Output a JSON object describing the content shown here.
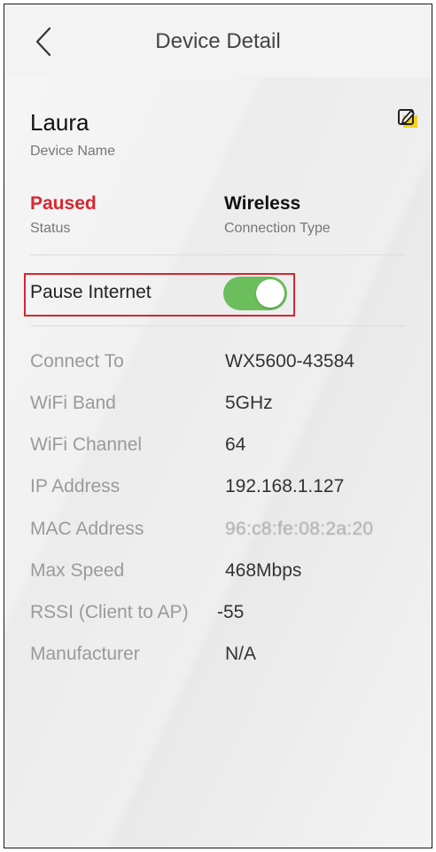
{
  "header": {
    "title": "Device Detail",
    "back_icon": "chevron-left-icon"
  },
  "device": {
    "name": "Laura",
    "name_label": "Device Name",
    "edit_icon": "edit-icon",
    "status": "Paused",
    "status_label": "Status",
    "status_color": "#d9262f",
    "connection_type": "Wireless",
    "connection_type_label": "Connection Type"
  },
  "pause_internet": {
    "label": "Pause Internet",
    "enabled": true,
    "toggle_color": "#6cbd5c",
    "highlight_color": "#d7262f"
  },
  "details": [
    {
      "label": "Connect To",
      "value": "WX5600-43584"
    },
    {
      "label": "WiFi Band",
      "value": "5GHz"
    },
    {
      "label": "WiFi Channel",
      "value": "64"
    },
    {
      "label": "IP Address",
      "value": "192.168.1.127"
    },
    {
      "label": "MAC Address",
      "value": "96:c8:fe:08:2a:20"
    },
    {
      "label": "Max Speed",
      "value": "468Mbps"
    },
    {
      "label": "RSSI (Client to AP)",
      "value": "-55"
    },
    {
      "label": "Manufacturer",
      "value": "N/A"
    }
  ]
}
